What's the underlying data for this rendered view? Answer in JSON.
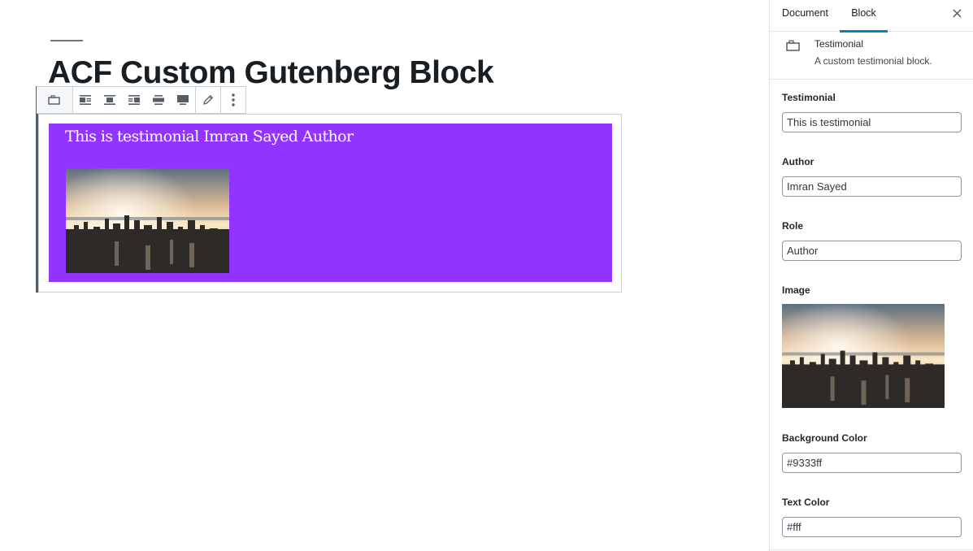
{
  "post": {
    "title": "ACF Custom Gutenberg Block"
  },
  "toolbar": {
    "buttons": [
      {
        "icon": "block-type-icon"
      },
      {
        "icon": "align-left-icon"
      },
      {
        "icon": "align-center-icon"
      },
      {
        "icon": "align-right-icon"
      },
      {
        "icon": "wide-width-icon"
      },
      {
        "icon": "full-width-icon"
      },
      {
        "icon": "edit-pencil-icon"
      },
      {
        "icon": "more-options-icon"
      }
    ]
  },
  "block": {
    "text": "This is testimonial Imran Sayed Author",
    "background_color": "#9333ff",
    "text_color": "#fff"
  },
  "sidebar": {
    "tabs": {
      "document": "Document",
      "block": "Block"
    },
    "active_tab": "Block",
    "close_icon": "×",
    "card": {
      "title": "Testimonial",
      "description": "A custom testimonial block."
    },
    "fields": {
      "testimonial": {
        "label": "Testimonial",
        "value": "This is testimonial"
      },
      "author": {
        "label": "Author",
        "value": "Imran Sayed"
      },
      "role": {
        "label": "Role",
        "value": "Author"
      },
      "image": {
        "label": "Image"
      },
      "background_color": {
        "label": "Background Color",
        "value": "#9333ff"
      },
      "text_color": {
        "label": "Text Color",
        "value": "#fff"
      }
    }
  }
}
